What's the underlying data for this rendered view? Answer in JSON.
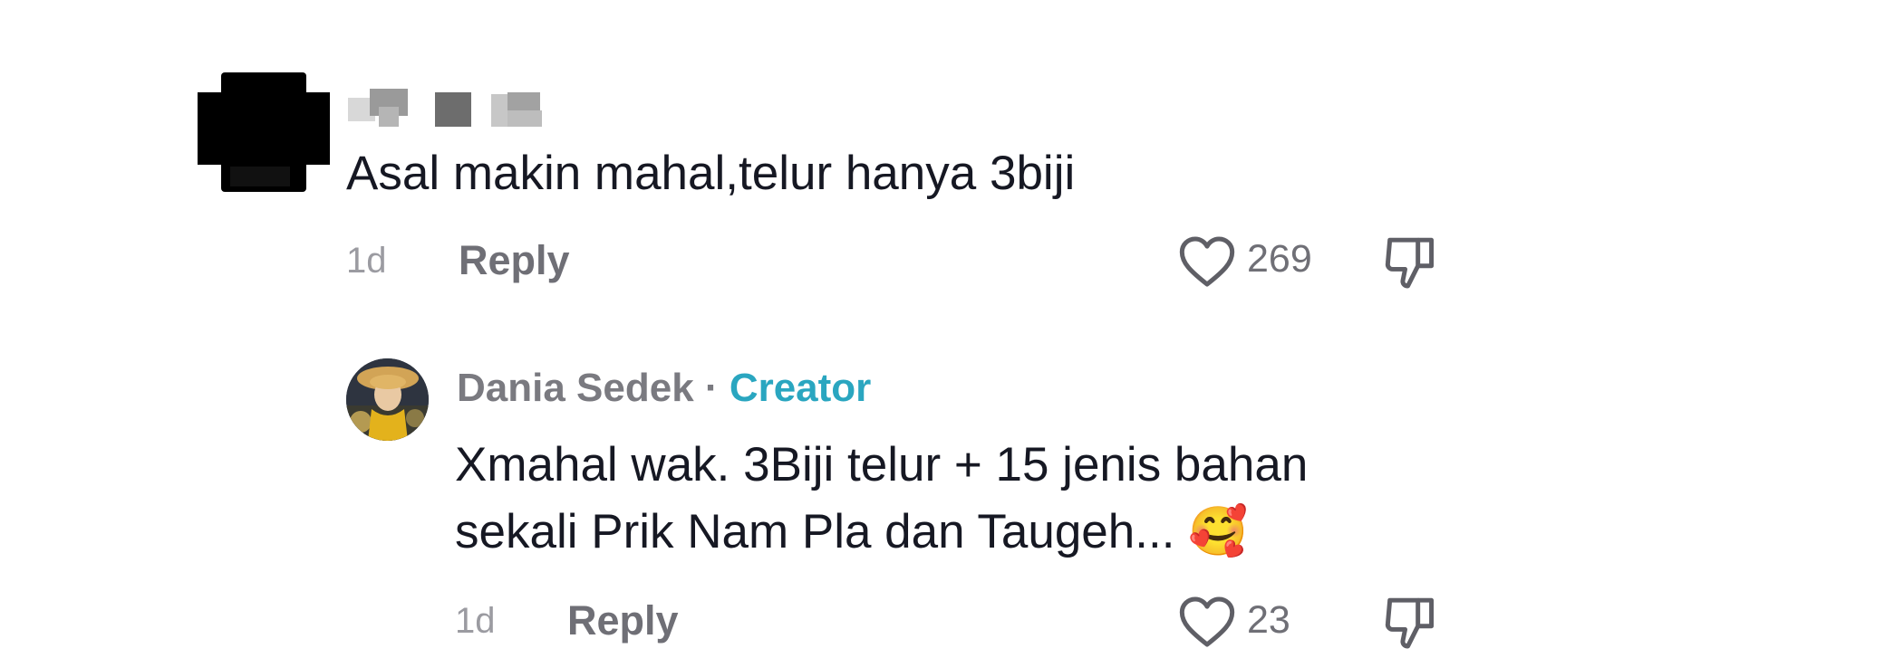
{
  "comment": {
    "text": "Asal makin mahal,telur hanya 3biji",
    "time": "1d",
    "reply_label": "Reply",
    "likes": "269",
    "avatar_icon": "blurred-avatar",
    "like_icon": "heart-outline-icon",
    "dislike_icon": "thumbs-down-icon"
  },
  "reply": {
    "author": "Dania Sedek",
    "separator": "·",
    "badge": "Creator",
    "line1": "Xmahal wak. 3Biji telur + 15 jenis bahan",
    "line2": "sekali Prik Nam Pla dan Taugeh...",
    "emoji": "🥰",
    "time": "1d",
    "reply_label": "Reply",
    "likes": "23",
    "like_icon": "heart-outline-icon",
    "dislike_icon": "thumbs-down-icon"
  },
  "colors": {
    "text": "#161823",
    "muted": "#6f6f76",
    "time": "#9b9ba1",
    "creator": "#2aa6c0"
  }
}
